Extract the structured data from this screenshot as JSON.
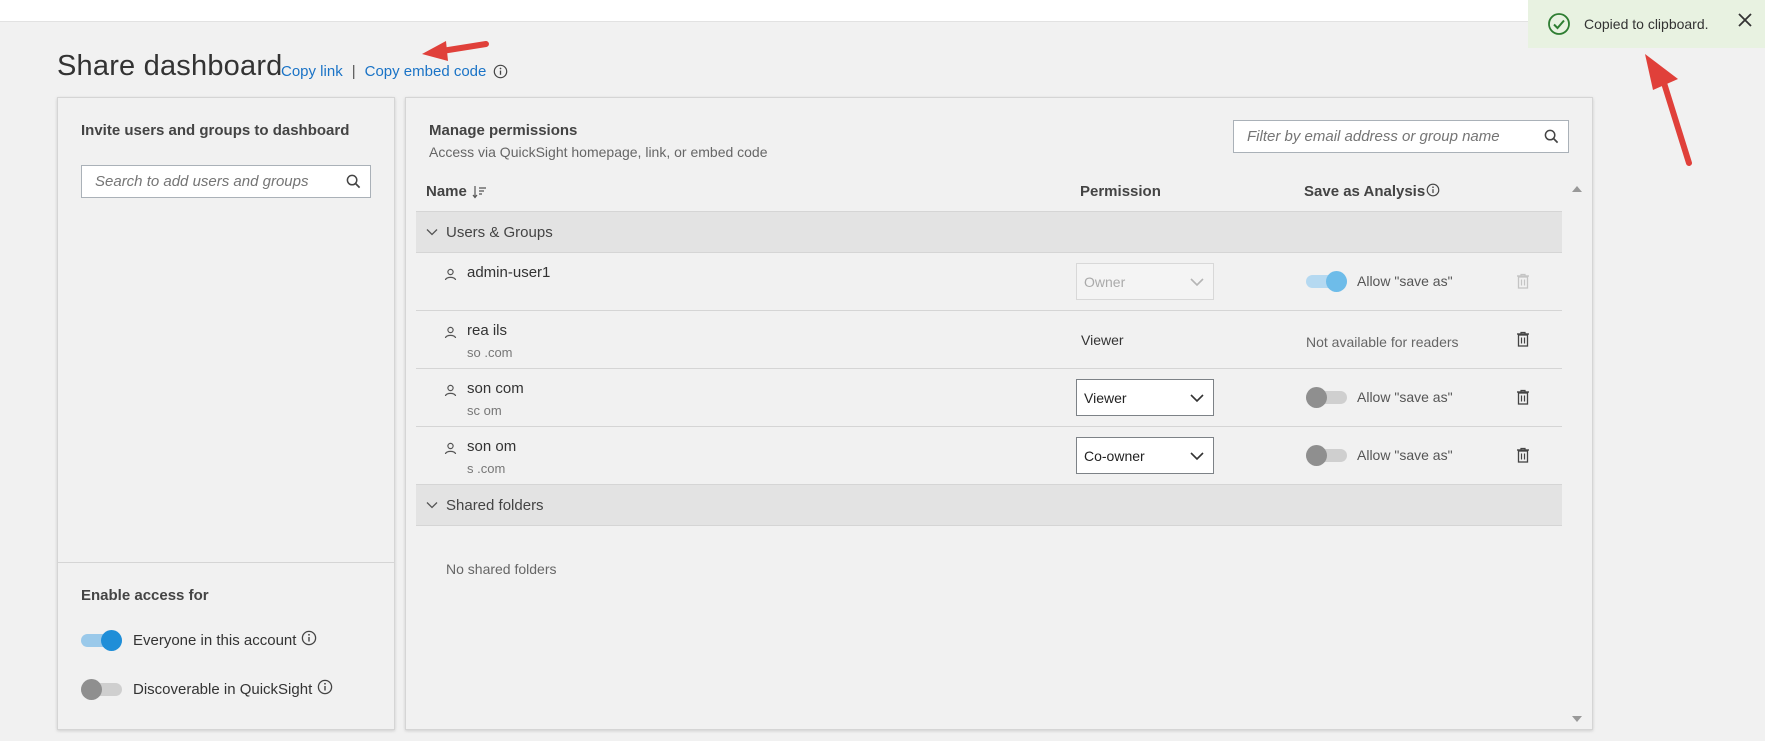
{
  "page": {
    "title": "Share dashboard",
    "copy_link": "Copy link",
    "separator": "|",
    "copy_embed_code": "Copy embed code"
  },
  "toast": {
    "message": "Copied to clipboard."
  },
  "invite": {
    "title": "Invite users and groups to dashboard",
    "search_placeholder": "Search to add users and groups"
  },
  "enable_access": {
    "title": "Enable access for",
    "options": [
      {
        "label": "Everyone in this account",
        "enabled": true
      },
      {
        "label": "Discoverable in QuickSight",
        "enabled": false
      }
    ]
  },
  "permissions": {
    "title": "Manage permissions",
    "subtitle": "Access via QuickSight homepage, link, or embed code",
    "filter_placeholder": "Filter by email address or group name",
    "columns": {
      "name": "Name",
      "permission": "Permission",
      "save_as": "Save as Analysis"
    },
    "groups_label": "Users & Groups",
    "users": [
      {
        "name": "admin-user1",
        "email": "",
        "permission": "Owner",
        "permission_mode": "disabled-select",
        "save_as": "Allow \"save as\"",
        "save_as_enabled": true
      },
      {
        "name": "rea        ils",
        "email": "so                      .com",
        "permission": "Viewer",
        "permission_mode": "text",
        "save_as": "Not available for readers",
        "save_as_enabled": false
      },
      {
        "name": "son                                    com",
        "email": "sc                             om",
        "permission": "Viewer",
        "permission_mode": "select",
        "save_as": "Allow \"save as\"",
        "save_as_enabled": false
      },
      {
        "name": "son                     om",
        "email": "s                    .com",
        "permission": "Co-owner",
        "permission_mode": "select",
        "save_as": "Allow \"save as\"",
        "save_as_enabled": false
      }
    ],
    "folders_label": "Shared folders",
    "no_folders": "No shared folders"
  },
  "colors": {
    "link": "#1a73c6",
    "toggle_on": "#1f8ed8",
    "toast_bg": "#e8f2e1",
    "toast_check": "#2e7d32",
    "annotation_arrow": "#e0403a"
  }
}
